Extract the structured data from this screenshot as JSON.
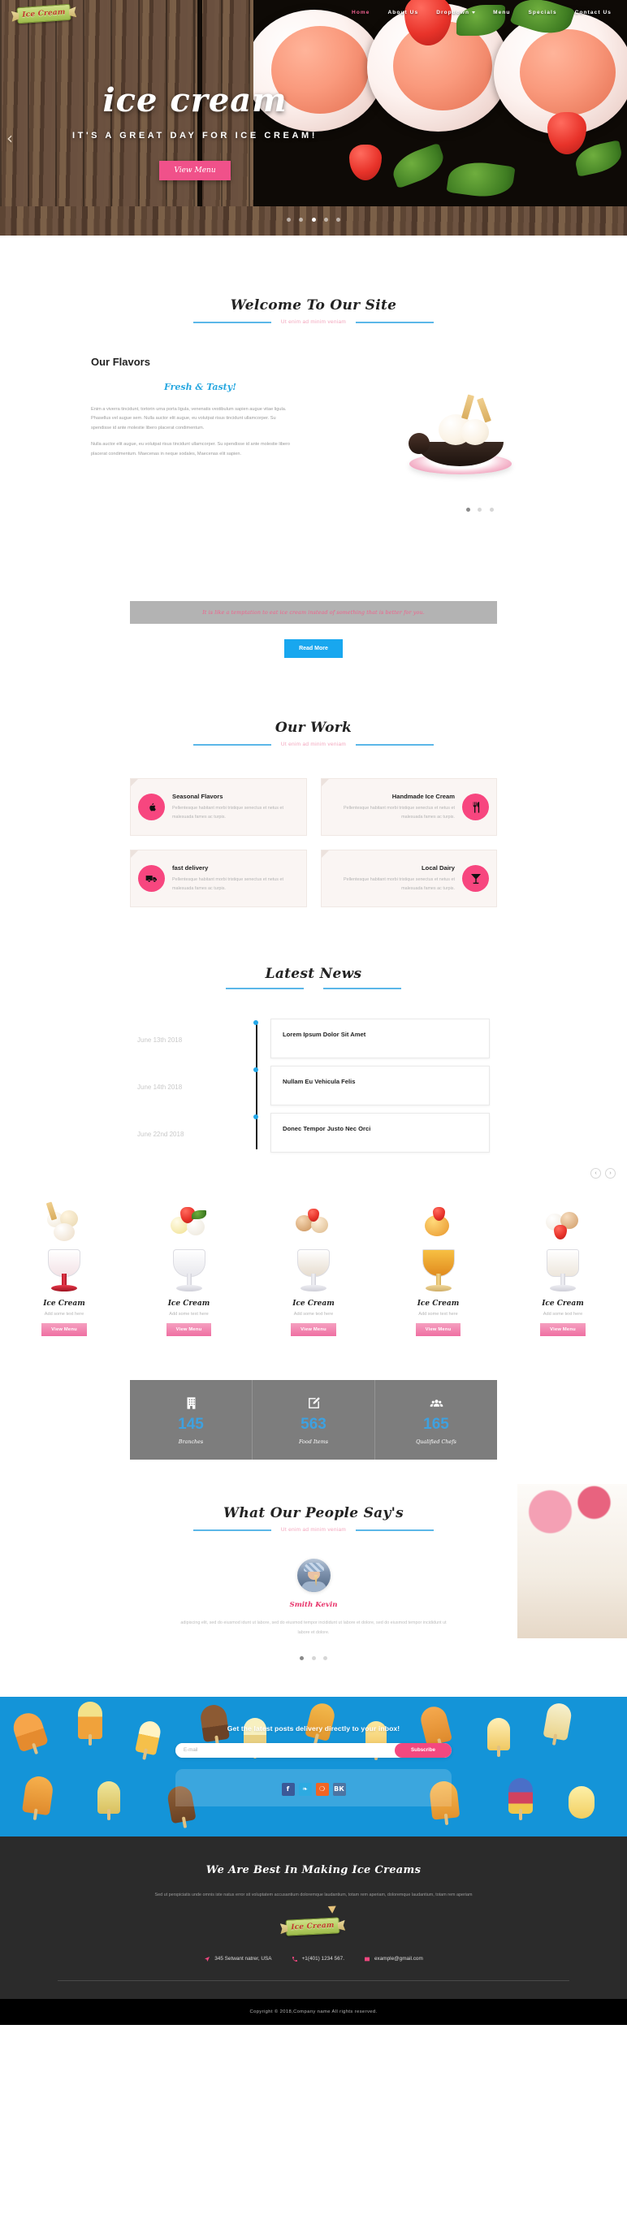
{
  "brand": {
    "name": "Ice Cream",
    "logo_icon": "ice-cream-cone-logo"
  },
  "nav": {
    "items": [
      {
        "label": "Home",
        "active": true
      },
      {
        "label": "About Us",
        "active": false
      },
      {
        "label": "Dropdown",
        "active": false,
        "has_caret": true
      },
      {
        "label": "Menu",
        "active": false
      },
      {
        "label": "Specials",
        "active": false
      },
      {
        "label": "Contact Us",
        "active": false
      }
    ]
  },
  "hero": {
    "title": "ice cream",
    "subtitle": "IT'S A GREAT DAY FOR ICE CREAM!",
    "button": "View Menu",
    "prev_icon": "chevron-left-icon",
    "dots": 5,
    "active_dot": 2
  },
  "welcome": {
    "title": "Welcome To Our Site",
    "subtitle": "Ut enim ad minim veniam"
  },
  "flavors": {
    "heading": "Our Flavors",
    "script": "Fresh & Tasty!",
    "paragraphs": [
      "Enim a viverra tincidunt, tortorin urna porta ligula, venenatis vestibulum sapien augue vitae ligula. Phasellus vel augue sem. Nulla auctor elit augue, eu volutpat risus tincidunt ullamcorper. Su spendisse id ante molestie libero placerat condimentum.",
      "Nulla auctor elit augue, eu volutpat risus tincidunt ullamcorper. Su spendisse id ante molestie libero placerat condimentum. Maecenas in neque sodales, Maecenas elit sapien."
    ],
    "dots": 3,
    "active_dot": 0
  },
  "banner": {
    "text": "It is like a temptation to eat ice cream instead of something that is better for you.",
    "button": "Read More"
  },
  "work": {
    "title": "Our Work",
    "subtitle": "Ut enim ad minim veniam",
    "cards": [
      {
        "title": "Seasonal Flavors",
        "desc": "Pellentesque habitant morbi tristique senectus et netus et malesuada fames ac turpis.",
        "icon": "apple-icon",
        "align": "left"
      },
      {
        "title": "Handmade Ice Cream",
        "desc": "Pellentesque habitant morbi tristique senectus et netus et malesuada fames ac turpis.",
        "icon": "cutlery-icon",
        "align": "right"
      },
      {
        "title": "fast delivery",
        "desc": "Pellentesque habitant morbi tristique senectus et netus et malesuada fames ac turpis.",
        "icon": "truck-icon",
        "align": "left"
      },
      {
        "title": "Local Dairy",
        "desc": "Pellentesque habitant morbi tristique senectus et netus et malesuada fames ac turpis.",
        "icon": "cocktail-glass-icon",
        "align": "right"
      }
    ]
  },
  "news": {
    "title": "Latest News",
    "items": [
      {
        "date": "June 13th 2018",
        "headline": "Lorem Ipsum Dolor Sit Amet"
      },
      {
        "date": "June 14th 2018",
        "headline": "Nullam Eu Vehicula Felis"
      },
      {
        "date": "June 22nd 2018",
        "headline": "Donec Tempor Justo Nec Orci"
      }
    ]
  },
  "products": {
    "prev_icon": "chevron-left-icon",
    "next_icon": "chevron-right-icon",
    "items": [
      {
        "name": "Ice Cream",
        "sub": "Add some text here",
        "button": "View Menu"
      },
      {
        "name": "Ice Cream",
        "sub": "Add some text here",
        "button": "View Menu"
      },
      {
        "name": "Ice Cream",
        "sub": "Add some text here",
        "button": "View Menu"
      },
      {
        "name": "Ice Cream",
        "sub": "Add some text here",
        "button": "View Menu"
      },
      {
        "name": "Ice Cream",
        "sub": "Add some text here",
        "button": "View Menu"
      }
    ]
  },
  "stats": {
    "items": [
      {
        "icon": "building-icon",
        "number": "145",
        "label": "Branches"
      },
      {
        "icon": "edit-square-icon",
        "number": "563",
        "label": "Food Items"
      },
      {
        "icon": "people-group-icon",
        "number": "165",
        "label": "Qualified Chefs"
      }
    ]
  },
  "testimonial": {
    "title": "What Our People Say's",
    "subtitle": "Ut enim ad minim veniam",
    "avatar": "customer-avatar",
    "name": "Smith Kevin",
    "quote": "adipiscing elit, sed do eiusmod idunt ut labore, sed do eiusmod tempor incididunt ut labore et dolore, sed do eiusmod tempor incididunt ut labore et dolore.",
    "dots": 3,
    "active_dot": 0
  },
  "newsletter": {
    "title": "Get the latest posts delivery directly to your inbox!",
    "email_placeholder": "E-mail",
    "email_value": "",
    "button": "Subscribe",
    "social": [
      {
        "name": "facebook-icon",
        "glyph": "f"
      },
      {
        "name": "twitter-icon",
        "glyph": "❧"
      },
      {
        "name": "rss-icon",
        "glyph": "❍"
      },
      {
        "name": "vk-icon",
        "glyph": "ВК"
      }
    ]
  },
  "footer": {
    "title": "We Are Best In Making Ice Creams",
    "desc": "Sed ut perspiciatis unde omnis iste natus error sit voluptatem accusantium doloremque laudantium, totam rem aperiam, doloremque laudantium, totam rem aperiam",
    "address": "345 Setwant natrer, USA",
    "phone": "+1(401) 1234 567.",
    "email": "example@gmail.com",
    "address_icon": "location-arrow-icon",
    "phone_icon": "phone-icon",
    "email_icon": "envelope-icon",
    "copyright": "Copyright © 2018,Company name All rights reserved."
  },
  "colors": {
    "pink": "#f4487f",
    "blue": "#18a7ef",
    "sky": "#5bb7e8",
    "dark": "#2b2b2b"
  }
}
